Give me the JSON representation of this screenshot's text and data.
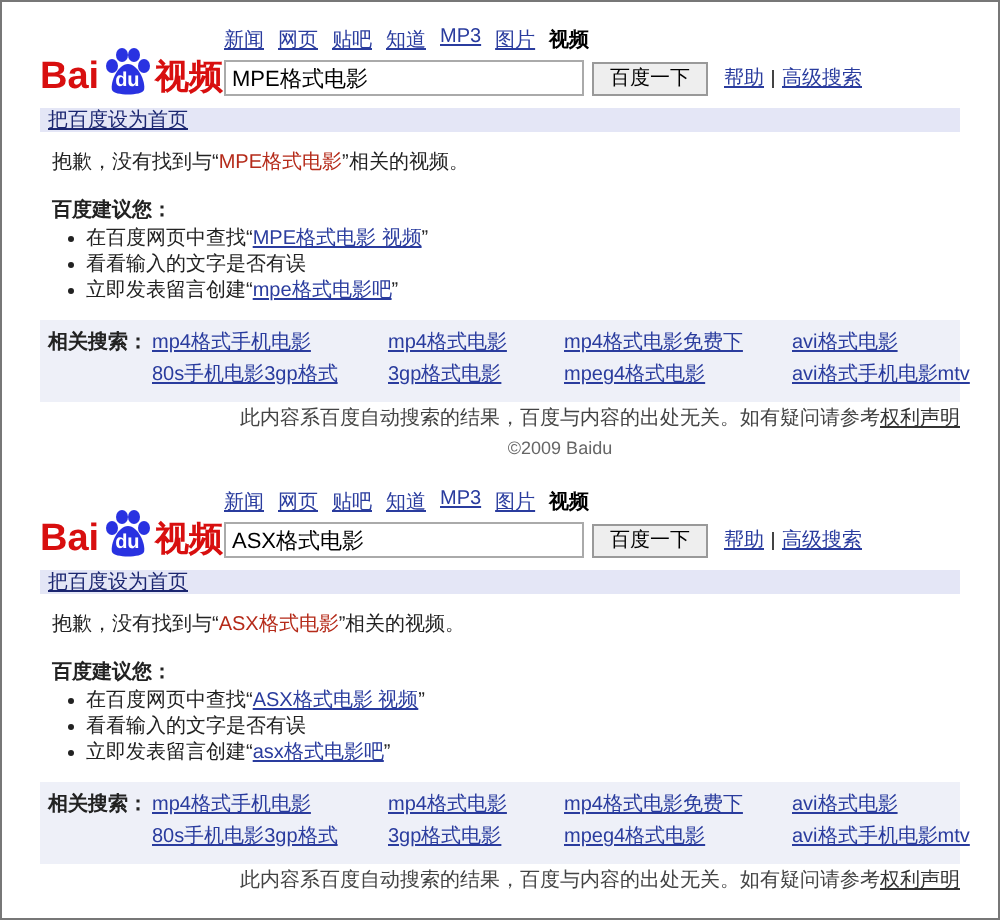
{
  "panels": [
    {
      "logo": {
        "left": "Bai",
        "paw": "du",
        "right": "视频"
      },
      "nav": [
        {
          "label": "新闻",
          "selected": false
        },
        {
          "label": "网页",
          "selected": false
        },
        {
          "label": "贴吧",
          "selected": false
        },
        {
          "label": "知道",
          "selected": false
        },
        {
          "label": "MP3",
          "selected": false
        },
        {
          "label": "图片",
          "selected": false
        },
        {
          "label": "视频",
          "selected": true
        }
      ],
      "query": "MPE格式电影",
      "search_button": "百度一下",
      "help_links": [
        "帮助",
        "高级搜索"
      ],
      "set_home": "把百度设为首页",
      "sorry": {
        "before": "抱歉，没有找到与“",
        "term": "MPE格式电影",
        "after": "”相关的视频。"
      },
      "suggest_title": "百度建议您：",
      "suggestions": [
        {
          "before": "在百度网页中查找“",
          "link": "MPE格式电影 视频",
          "after": "”"
        },
        {
          "before": "看看输入的文字是否有误"
        },
        {
          "before": "立即发表留言创建“",
          "link": "mpe格式电影吧",
          "after": "”"
        }
      ],
      "related_label": "相关搜索：",
      "related": [
        "mp4格式手机电影",
        "mp4格式电影",
        "mp4格式电影免费下",
        "avi格式电影",
        "80s手机电影3gp格式",
        "3gp格式电影",
        "mpeg4格式电影",
        "avi格式手机电影mtv"
      ],
      "disclaimer": {
        "text": "此内容系百度自动搜索的结果，百度与内容的出处无关。如有疑问请参考",
        "link": "权利声明"
      },
      "copyright": "©2009 Baidu"
    },
    {
      "logo": {
        "left": "Bai",
        "paw": "du",
        "right": "视频"
      },
      "nav": [
        {
          "label": "新闻",
          "selected": false
        },
        {
          "label": "网页",
          "selected": false
        },
        {
          "label": "贴吧",
          "selected": false
        },
        {
          "label": "知道",
          "selected": false
        },
        {
          "label": "MP3",
          "selected": false
        },
        {
          "label": "图片",
          "selected": false
        },
        {
          "label": "视频",
          "selected": true
        }
      ],
      "query": "ASX格式电影",
      "search_button": "百度一下",
      "help_links": [
        "帮助",
        "高级搜索"
      ],
      "set_home": "把百度设为首页",
      "sorry": {
        "before": "抱歉，没有找到与“",
        "term": "ASX格式电影",
        "after": "”相关的视频。"
      },
      "suggest_title": "百度建议您：",
      "suggestions": [
        {
          "before": "在百度网页中查找“",
          "link": "ASX格式电影 视频",
          "after": "”"
        },
        {
          "before": "看看输入的文字是否有误"
        },
        {
          "before": "立即发表留言创建“",
          "link": "asx格式电影吧",
          "after": "”"
        }
      ],
      "related_label": "相关搜索：",
      "related": [
        "mp4格式手机电影",
        "mp4格式电影",
        "mp4格式电影免费下",
        "avi格式电影",
        "80s手机电影3gp格式",
        "3gp格式电影",
        "mpeg4格式电影",
        "avi格式手机电影mtv"
      ],
      "disclaimer": {
        "text": "此内容系百度自动搜索的结果，百度与内容的出处无关。如有疑问请参考",
        "link": "权利声明"
      }
    }
  ]
}
